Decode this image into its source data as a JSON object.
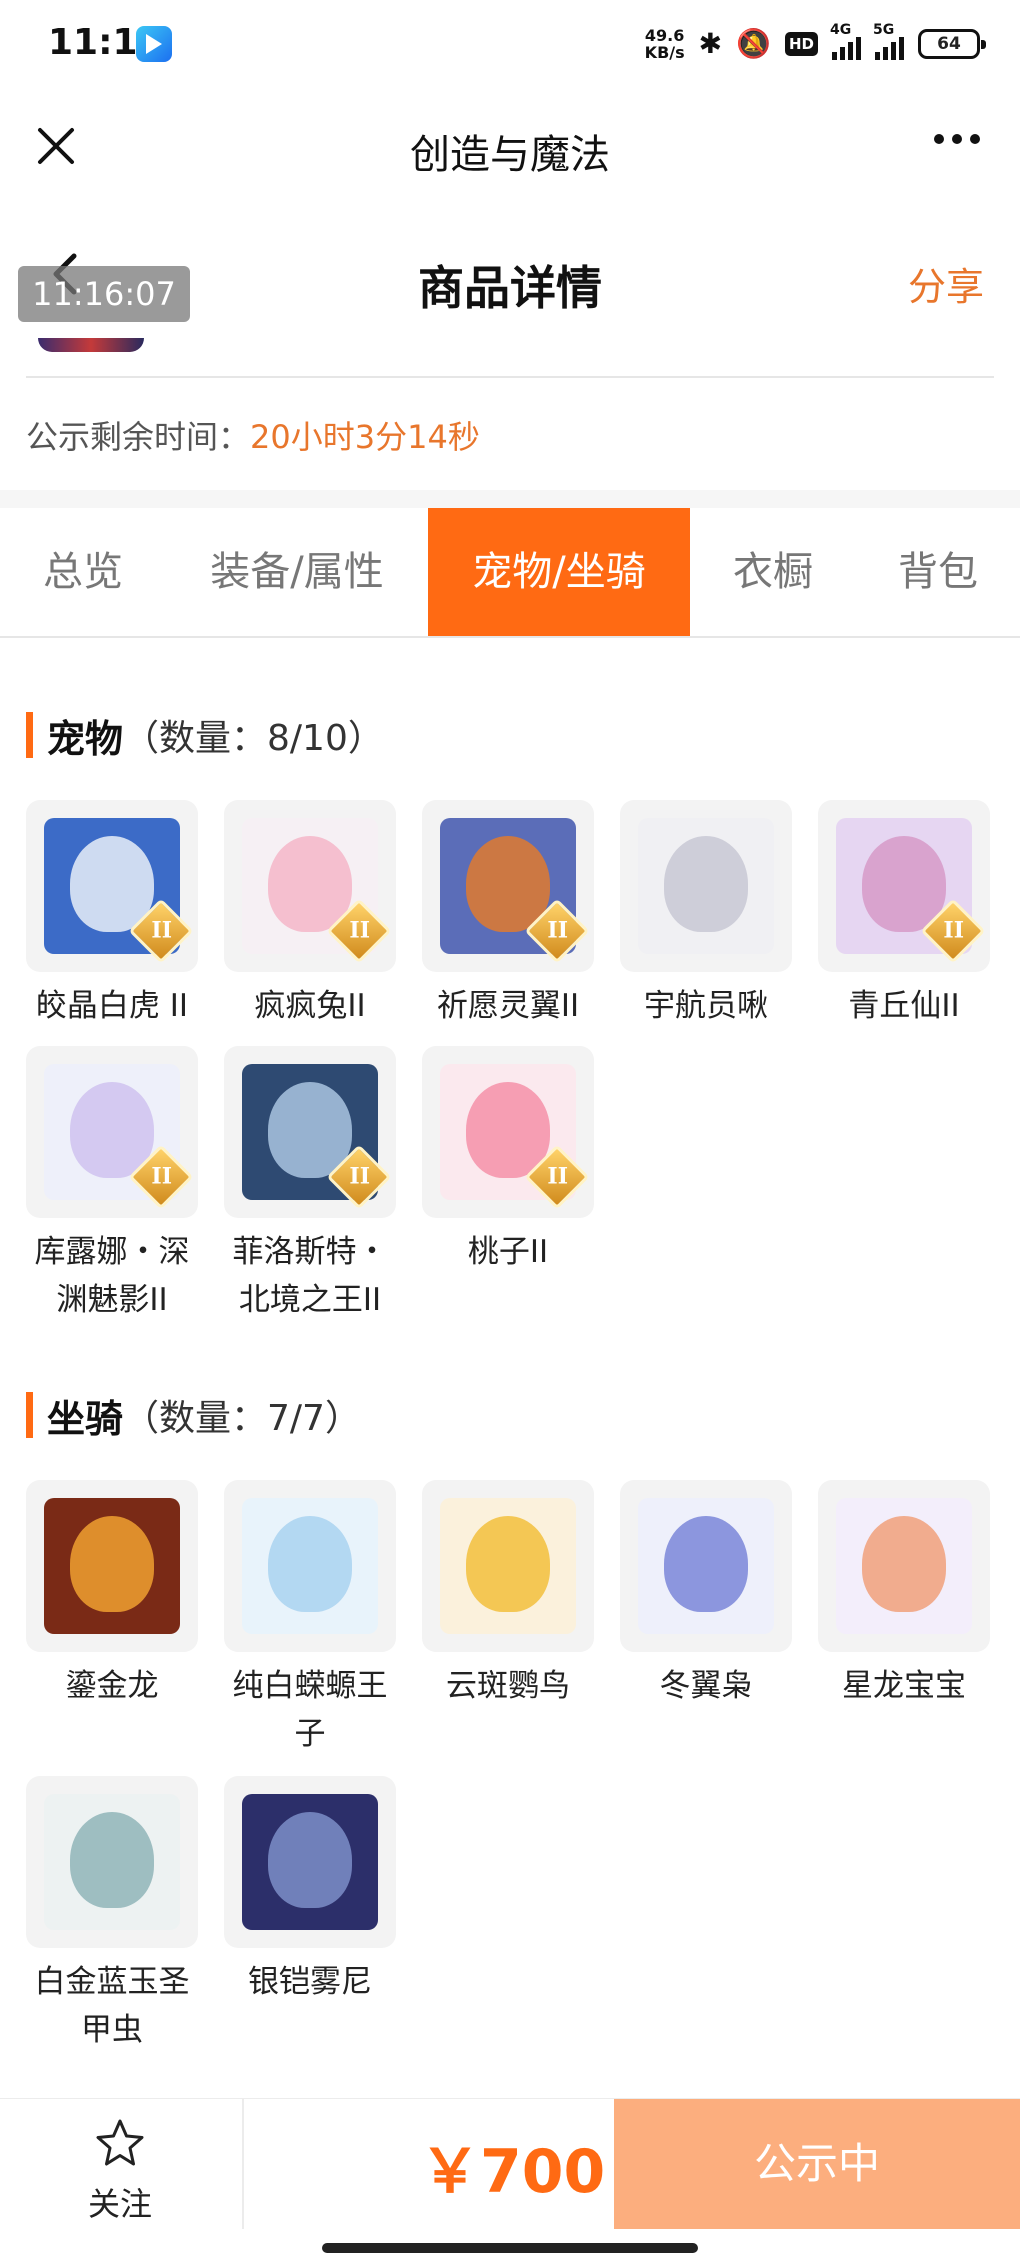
{
  "status_bar": {
    "time": "11:16",
    "net_speed": "49.6",
    "net_speed_unit": "KB/s",
    "hd_label": "HD",
    "sig1_label": "4G",
    "sig2_label": "5G",
    "battery": "64"
  },
  "app_header": {
    "title": "创造与魔法"
  },
  "page_header": {
    "title": "商品详情",
    "share": "分享",
    "timestamp": "11:16:07"
  },
  "notice": {
    "label": "公示剩余时间：",
    "remaining": "20小时3分14秒"
  },
  "tabs": [
    {
      "label": "总览",
      "active": false
    },
    {
      "label": "装备/属性",
      "active": false
    },
    {
      "label": "宠物/坐骑",
      "active": true
    },
    {
      "label": "衣橱",
      "active": false
    },
    {
      "label": "背包",
      "active": false
    }
  ],
  "pets": {
    "title": "宠物",
    "count": "（数量：8/10）",
    "items": [
      {
        "line1": "皎晶白虎 II",
        "line2": "",
        "badge": "II",
        "color": "#3c6bc7",
        "shape": "#e8eef8"
      },
      {
        "line1": "疯疯兔II",
        "line2": "",
        "badge": "II",
        "color": "#f6f0f4",
        "shape": "#f4b6c8"
      },
      {
        "line1": "祈愿灵翼II",
        "line2": "",
        "badge": "II",
        "color": "#5b6db8",
        "shape": "#e07a2e"
      },
      {
        "line1": "宇航员啾",
        "line2": "",
        "badge": "",
        "color": "#f0f0f3",
        "shape": "#c8c8d4"
      },
      {
        "line1": "青丘仙II",
        "line2": "",
        "badge": "II",
        "color": "#e6d6f2",
        "shape": "#d69ac8"
      },
      {
        "line1": "库露娜・深",
        "line2": "渊魅影II",
        "badge": "II",
        "color": "#eef0fa",
        "shape": "#cfc2ee"
      },
      {
        "line1": "菲洛斯特・",
        "line2": "北境之王II",
        "badge": "II",
        "color": "#2e4a72",
        "shape": "#a9c4e0"
      },
      {
        "line1": "桃子II",
        "line2": "",
        "badge": "II",
        "color": "#fbe9ee",
        "shape": "#f590a8"
      }
    ]
  },
  "mounts": {
    "title": "坐骑",
    "count": "（数量：7/7）",
    "items": [
      {
        "line1": "鎏金龙",
        "line2": "",
        "color": "#7a2a16",
        "shape": "#f0a030"
      },
      {
        "line1": "纯白蝾螈王",
        "line2": "子",
        "color": "#e8f3fb",
        "shape": "#a9d2f0"
      },
      {
        "line1": "云斑鹦鸟",
        "line2": "",
        "color": "#fbf1dc",
        "shape": "#f2bf3c"
      },
      {
        "line1": "冬翼枭",
        "line2": "",
        "color": "#eef0fb",
        "shape": "#7a86d8"
      },
      {
        "line1": "星龙宝宝",
        "line2": "",
        "color": "#f3eefb",
        "shape": "#f0a07a"
      },
      {
        "line1": "白金蓝玉圣",
        "line2": "甲虫",
        "color": "#edf2f2",
        "shape": "#8fb5b8"
      },
      {
        "line1": "银铠雾尼",
        "line2": "",
        "color": "#2c2f6a",
        "shape": "#7d8ec8"
      }
    ]
  },
  "bottom_bar": {
    "follow": "关注",
    "price": "￥700",
    "status": "公示中"
  },
  "colors": {
    "accent": "#ff6a13",
    "share": "#e8762c",
    "status_button": "#fcae7e"
  }
}
